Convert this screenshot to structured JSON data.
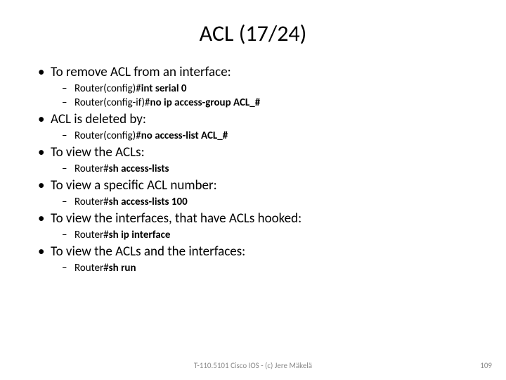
{
  "title": "ACL (17/24)",
  "b1": "To remove ACL from an interface:",
  "b1s1a": "Router(config)#",
  "b1s1b": "int serial 0",
  "b1s2a": "Router(config-if)#",
  "b1s2b": "no ip access-group ACL_#",
  "b2": "ACL is deleted by:",
  "b2s1a": "Router(config)#",
  "b2s1b": "no access-list ACL_#",
  "b3": "To view the ACLs:",
  "b3s1a": "Router#",
  "b3s1b": "sh access-lists",
  "b4": "To view a specific ACL number:",
  "b4s1a": "Router#",
  "b4s1b": "sh access-lists 100",
  "b5": "To view the interfaces, that have ACLs hooked:",
  "b5s1a": "Router#",
  "b5s1b": "sh ip interface",
  "b6": "To view the ACLs and the interfaces:",
  "b6s1a": "Router#",
  "b6s1b": "sh run",
  "footer_center": "T-110.5101 Cisco IOS - (c) Jere Mäkelä",
  "footer_right": "109"
}
